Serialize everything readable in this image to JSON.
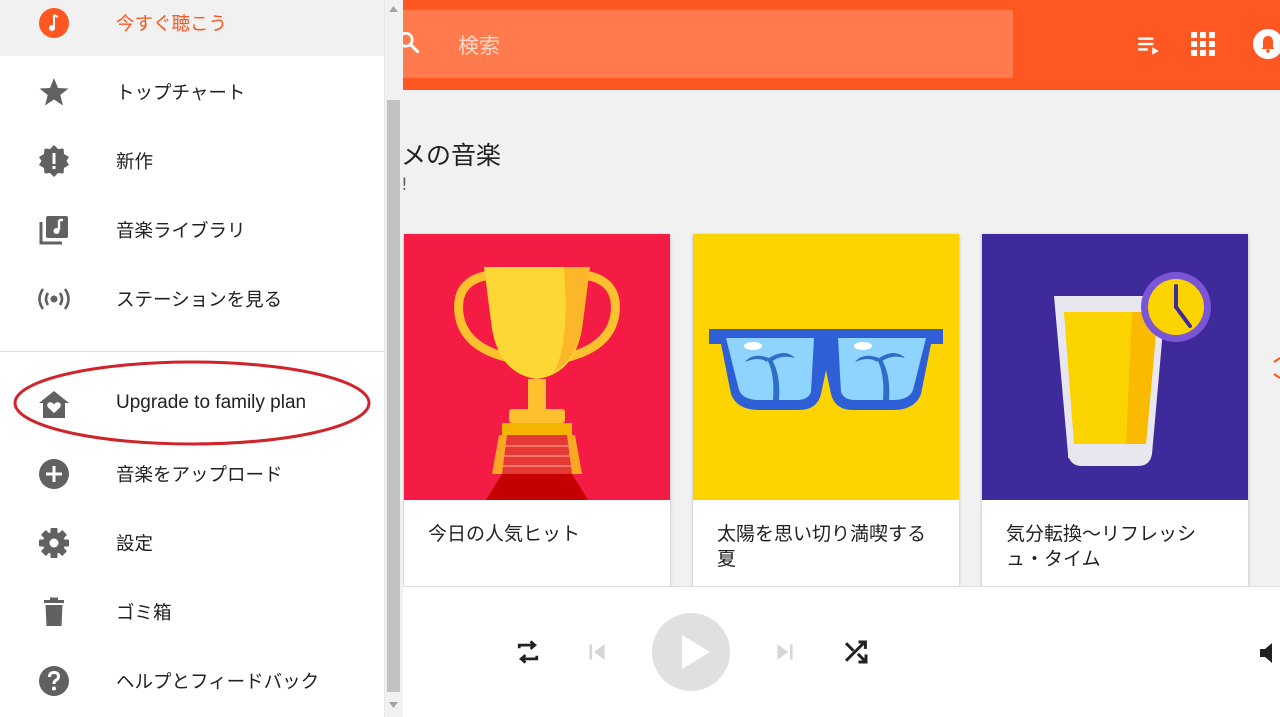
{
  "header": {
    "search_placeholder": "検索",
    "icons": [
      "search-icon",
      "queue-icon",
      "apps-icon",
      "notifications-icon"
    ],
    "accent_color": "#fe5722"
  },
  "main": {
    "section_title": "メの音楽",
    "section_subtitle": "!",
    "cards": [
      {
        "title": "今日の人気ヒット",
        "art_color": "#f41c44",
        "art": "trophy-art"
      },
      {
        "title": "太陽を思い切り満喫する夏",
        "art_color": "#fed400",
        "art": "sunglasses-art"
      },
      {
        "title": "気分転換〜リフレッシュ・タイム",
        "art_color": "#3f2a9b",
        "art": "juice-clock-art"
      }
    ]
  },
  "drawer": {
    "items": [
      {
        "label": "今すぐ聴こう",
        "icon": "listen-now-icon",
        "active": true
      },
      {
        "label": "トップチャート",
        "icon": "star-icon"
      },
      {
        "label": "新作",
        "icon": "new-release-icon"
      },
      {
        "label": "音楽ライブラリ",
        "icon": "library-music-icon"
      },
      {
        "label": "ステーションを見る",
        "icon": "radio-station-icon"
      },
      {
        "label": "Upgrade to family plan",
        "icon": "family-home-icon"
      },
      {
        "label": "音楽をアップロード",
        "icon": "add-circle-icon"
      },
      {
        "label": "設定",
        "icon": "gear-icon"
      },
      {
        "label": "ゴミ箱",
        "icon": "trash-icon"
      },
      {
        "label": "ヘルプとフィードバック",
        "icon": "help-icon"
      }
    ],
    "annotation_color": "#d0232b"
  },
  "player": {
    "icons": [
      "repeat-icon",
      "previous-icon",
      "play-icon",
      "next-icon",
      "shuffle-icon",
      "volume-icon"
    ]
  }
}
